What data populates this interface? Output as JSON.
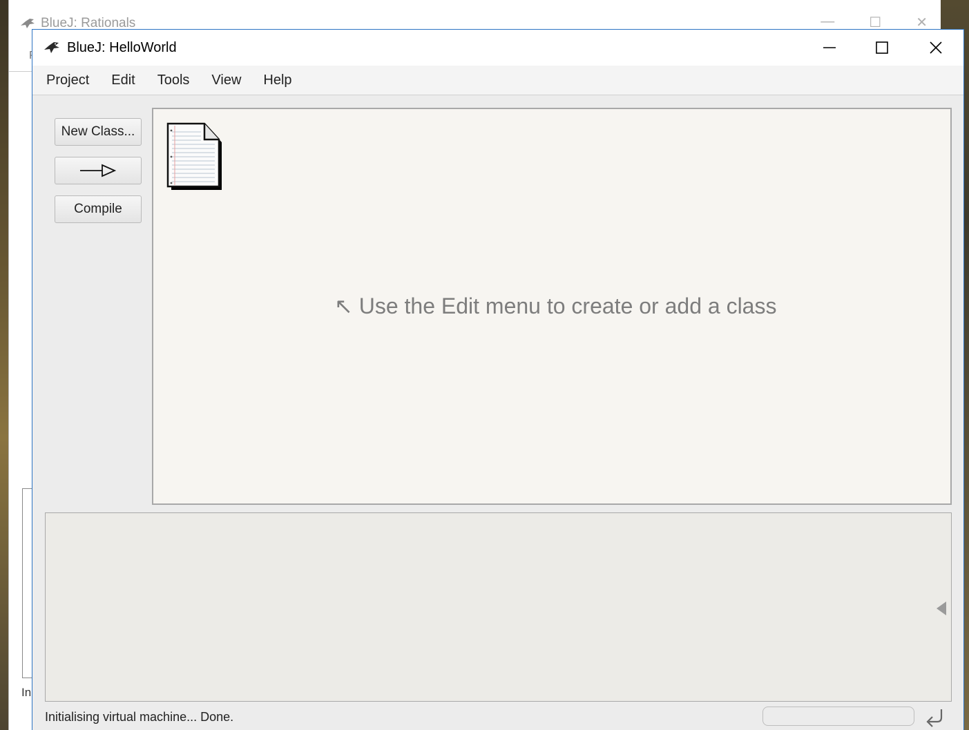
{
  "background_window": {
    "title": "BlueJ:  Rationals",
    "menu_letter": "P",
    "status_fragment": "In"
  },
  "window": {
    "title": "BlueJ:  HelloWorld",
    "controls": {
      "minimize": "—",
      "maximize": "☐",
      "close": "✕"
    }
  },
  "menu": {
    "items": [
      "Project",
      "Edit",
      "Tools",
      "View",
      "Help"
    ]
  },
  "toolbar": {
    "new_class_label": "New Class...",
    "arrow_label": "—▷",
    "compile_label": "Compile"
  },
  "canvas": {
    "hint": "↖ Use the Edit menu to create or add a class",
    "readme_icon": "readme-document-icon"
  },
  "status": {
    "message": "Initialising virtual machine... Done."
  },
  "colors": {
    "accent_border": "#2b73c3",
    "canvas_bg": "#f7f5f1",
    "bench_bg": "#ecebe7"
  }
}
